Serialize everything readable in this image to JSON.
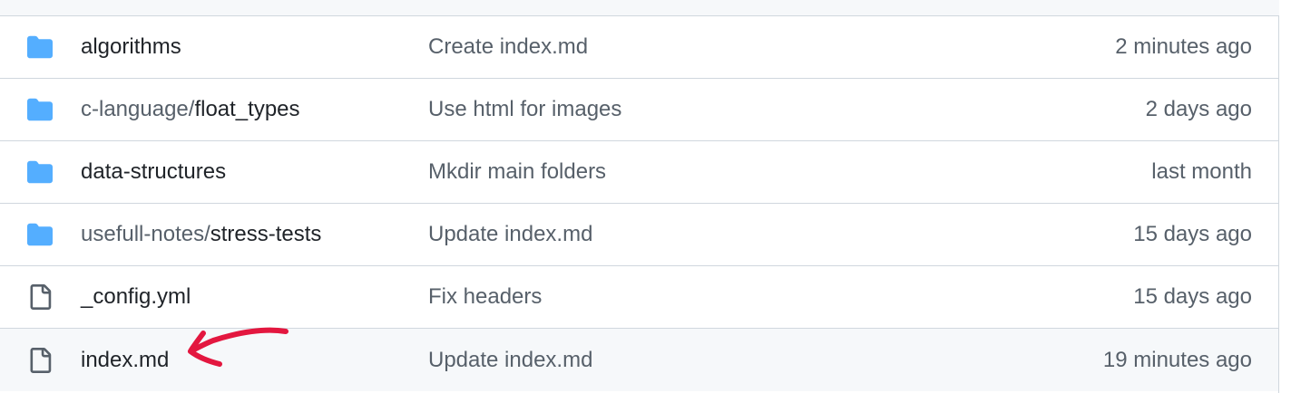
{
  "colors": {
    "folder": "#54aeff",
    "file": "#57606a",
    "border": "#d0d7de",
    "hover_row": "#f6f8fa",
    "annotation": "#e3173f"
  },
  "files": [
    {
      "type": "folder",
      "icon": "folder-icon",
      "prefix": "",
      "name": "algorithms",
      "message": "Create index.md",
      "age": "2 minutes ago"
    },
    {
      "type": "folder",
      "icon": "folder-icon",
      "prefix": "c-language/",
      "name": "float_types",
      "message": "Use html for images",
      "age": "2 days ago"
    },
    {
      "type": "folder",
      "icon": "folder-icon",
      "prefix": "",
      "name": "data-structures",
      "message": "Mkdir main folders",
      "age": "last month"
    },
    {
      "type": "folder",
      "icon": "folder-icon",
      "prefix": "usefull-notes/",
      "name": "stress-tests",
      "message": "Update index.md",
      "age": "15 days ago"
    },
    {
      "type": "file",
      "icon": "file-icon",
      "prefix": "",
      "name": "_config.yml",
      "message": "Fix headers",
      "age": "15 days ago"
    },
    {
      "type": "file",
      "icon": "file-icon",
      "prefix": "",
      "name": "index.md",
      "message": "Update index.md",
      "age": "19 minutes ago"
    }
  ]
}
